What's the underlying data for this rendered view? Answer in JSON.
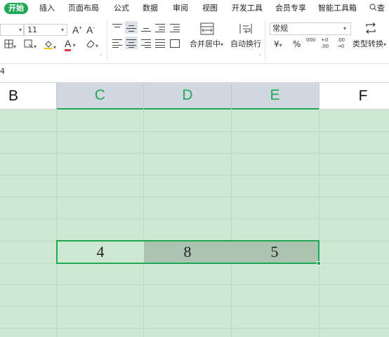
{
  "menu": {
    "tabs": [
      {
        "label": "开始",
        "active": true
      },
      {
        "label": "插入"
      },
      {
        "label": "页面布局"
      },
      {
        "label": "公式"
      },
      {
        "label": "数据"
      },
      {
        "label": "审阅"
      },
      {
        "label": "视图"
      },
      {
        "label": "开发工具"
      },
      {
        "label": "会员专享"
      },
      {
        "label": "智能工具箱"
      }
    ],
    "search_label": "查",
    "active_color": "#1fa855"
  },
  "ribbon": {
    "font_size": "11",
    "grow_font_label": "A",
    "shrink_font_label": "A",
    "font_color_label": "A",
    "merge_center_label": "合并居中",
    "wrap_text_label": "自动换行",
    "number_format_value": "常规",
    "currency_label": "¥",
    "percent_label": "%",
    "thousands_label": "000",
    "inc_decimal_label": "+0 .00",
    "dec_decimal_label": ".00 →0",
    "type_convert_label": "类型转换"
  },
  "formula_bar": {
    "value": "4"
  },
  "grid": {
    "columns": [
      {
        "label": "B",
        "selected": false
      },
      {
        "label": "C",
        "selected": true
      },
      {
        "label": "D",
        "selected": true
      },
      {
        "label": "E",
        "selected": true
      },
      {
        "label": "F",
        "selected": false
      }
    ],
    "selected_row_values": [
      "4",
      "8",
      "5"
    ],
    "selection_color": "#1fa855",
    "sheet_background": "#cde7d3",
    "selected_cell_fill": "#adc3b1"
  }
}
